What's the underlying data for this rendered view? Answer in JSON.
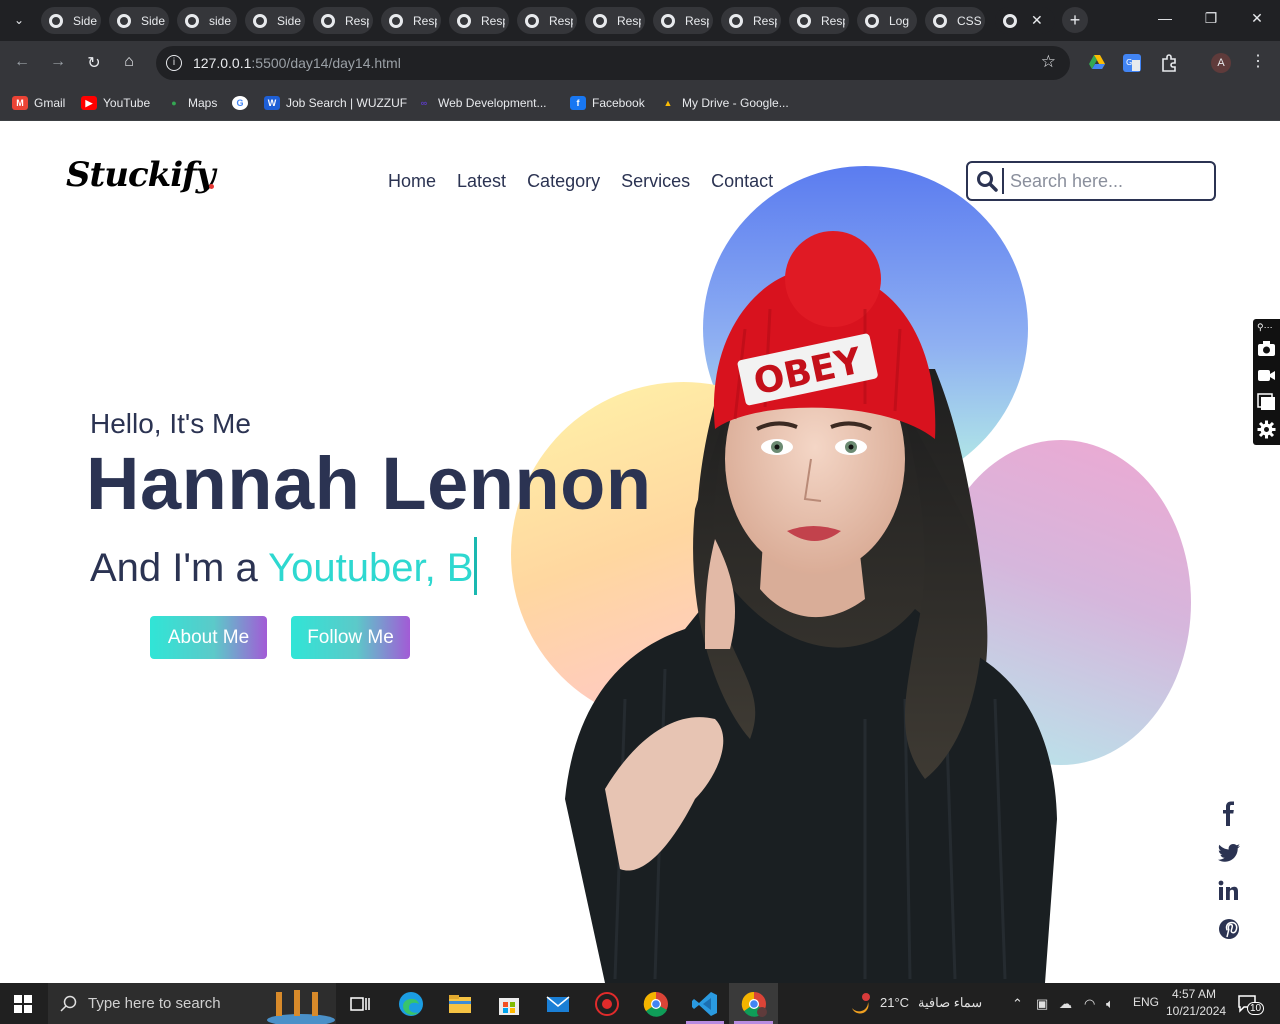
{
  "browser": {
    "tabs": [
      {
        "label": "Side"
      },
      {
        "label": "Side"
      },
      {
        "label": "side"
      },
      {
        "label": "Side"
      },
      {
        "label": "Resp"
      },
      {
        "label": "Resp"
      },
      {
        "label": "Resp"
      },
      {
        "label": "Resp"
      },
      {
        "label": "Resp"
      },
      {
        "label": "Resp"
      },
      {
        "label": "Resp"
      },
      {
        "label": "Resp"
      },
      {
        "label": "Log"
      },
      {
        "label": "CSS"
      }
    ],
    "url_host": "127.0.0.1",
    "url_path": ":5500/day14/day14.html",
    "profile_initial": "A",
    "bookmarks": [
      {
        "label": "Gmail",
        "icon": "gmail-icon",
        "color": "#ea4335"
      },
      {
        "label": "YouTube",
        "icon": "youtube-icon",
        "color": "#ff0000"
      },
      {
        "label": "Maps",
        "icon": "maps-icon",
        "color": "#34a853"
      },
      {
        "label": "",
        "icon": "google-icon",
        "color": "#ffffff"
      },
      {
        "label": "Job Search | WUZZUF",
        "icon": "wuzzuf-icon",
        "color": "#1e5fd6"
      },
      {
        "label": "Web Development...",
        "icon": "web-dev-icon",
        "color": "#5b3cc4"
      },
      {
        "label": "Facebook",
        "icon": "facebook-icon",
        "color": "#1877f2"
      },
      {
        "label": "My Drive - Google...",
        "icon": "drive-icon",
        "color": "#fbbc04"
      }
    ]
  },
  "site": {
    "logo": "Stuckify",
    "nav": [
      "Home",
      "Latest",
      "Category",
      "Services",
      "Contact"
    ],
    "search_placeholder": "Search here...",
    "hero": {
      "greeting": "Hello, It's Me",
      "name": "Hannah Lennon",
      "role_prefix": "And I'm a ",
      "role_typed": "Youtuber, B",
      "buttons": [
        "About Me",
        "Follow Me"
      ]
    },
    "social": [
      "facebook-icon",
      "twitter-icon",
      "linkedin-icon",
      "pinterest-icon"
    ],
    "beanie_text": "OBEY",
    "colors": {
      "primary": "#2b3352",
      "accent": "#2ed8d0",
      "gradient_end": "#a25bd6"
    }
  },
  "taskbar": {
    "search_placeholder": "Type here to search",
    "weather_temp": "21°C",
    "weather_desc": "سماء صافية",
    "language": "ENG",
    "time": "4:57 AM",
    "date": "10/21/2024",
    "notification_count": "10"
  }
}
